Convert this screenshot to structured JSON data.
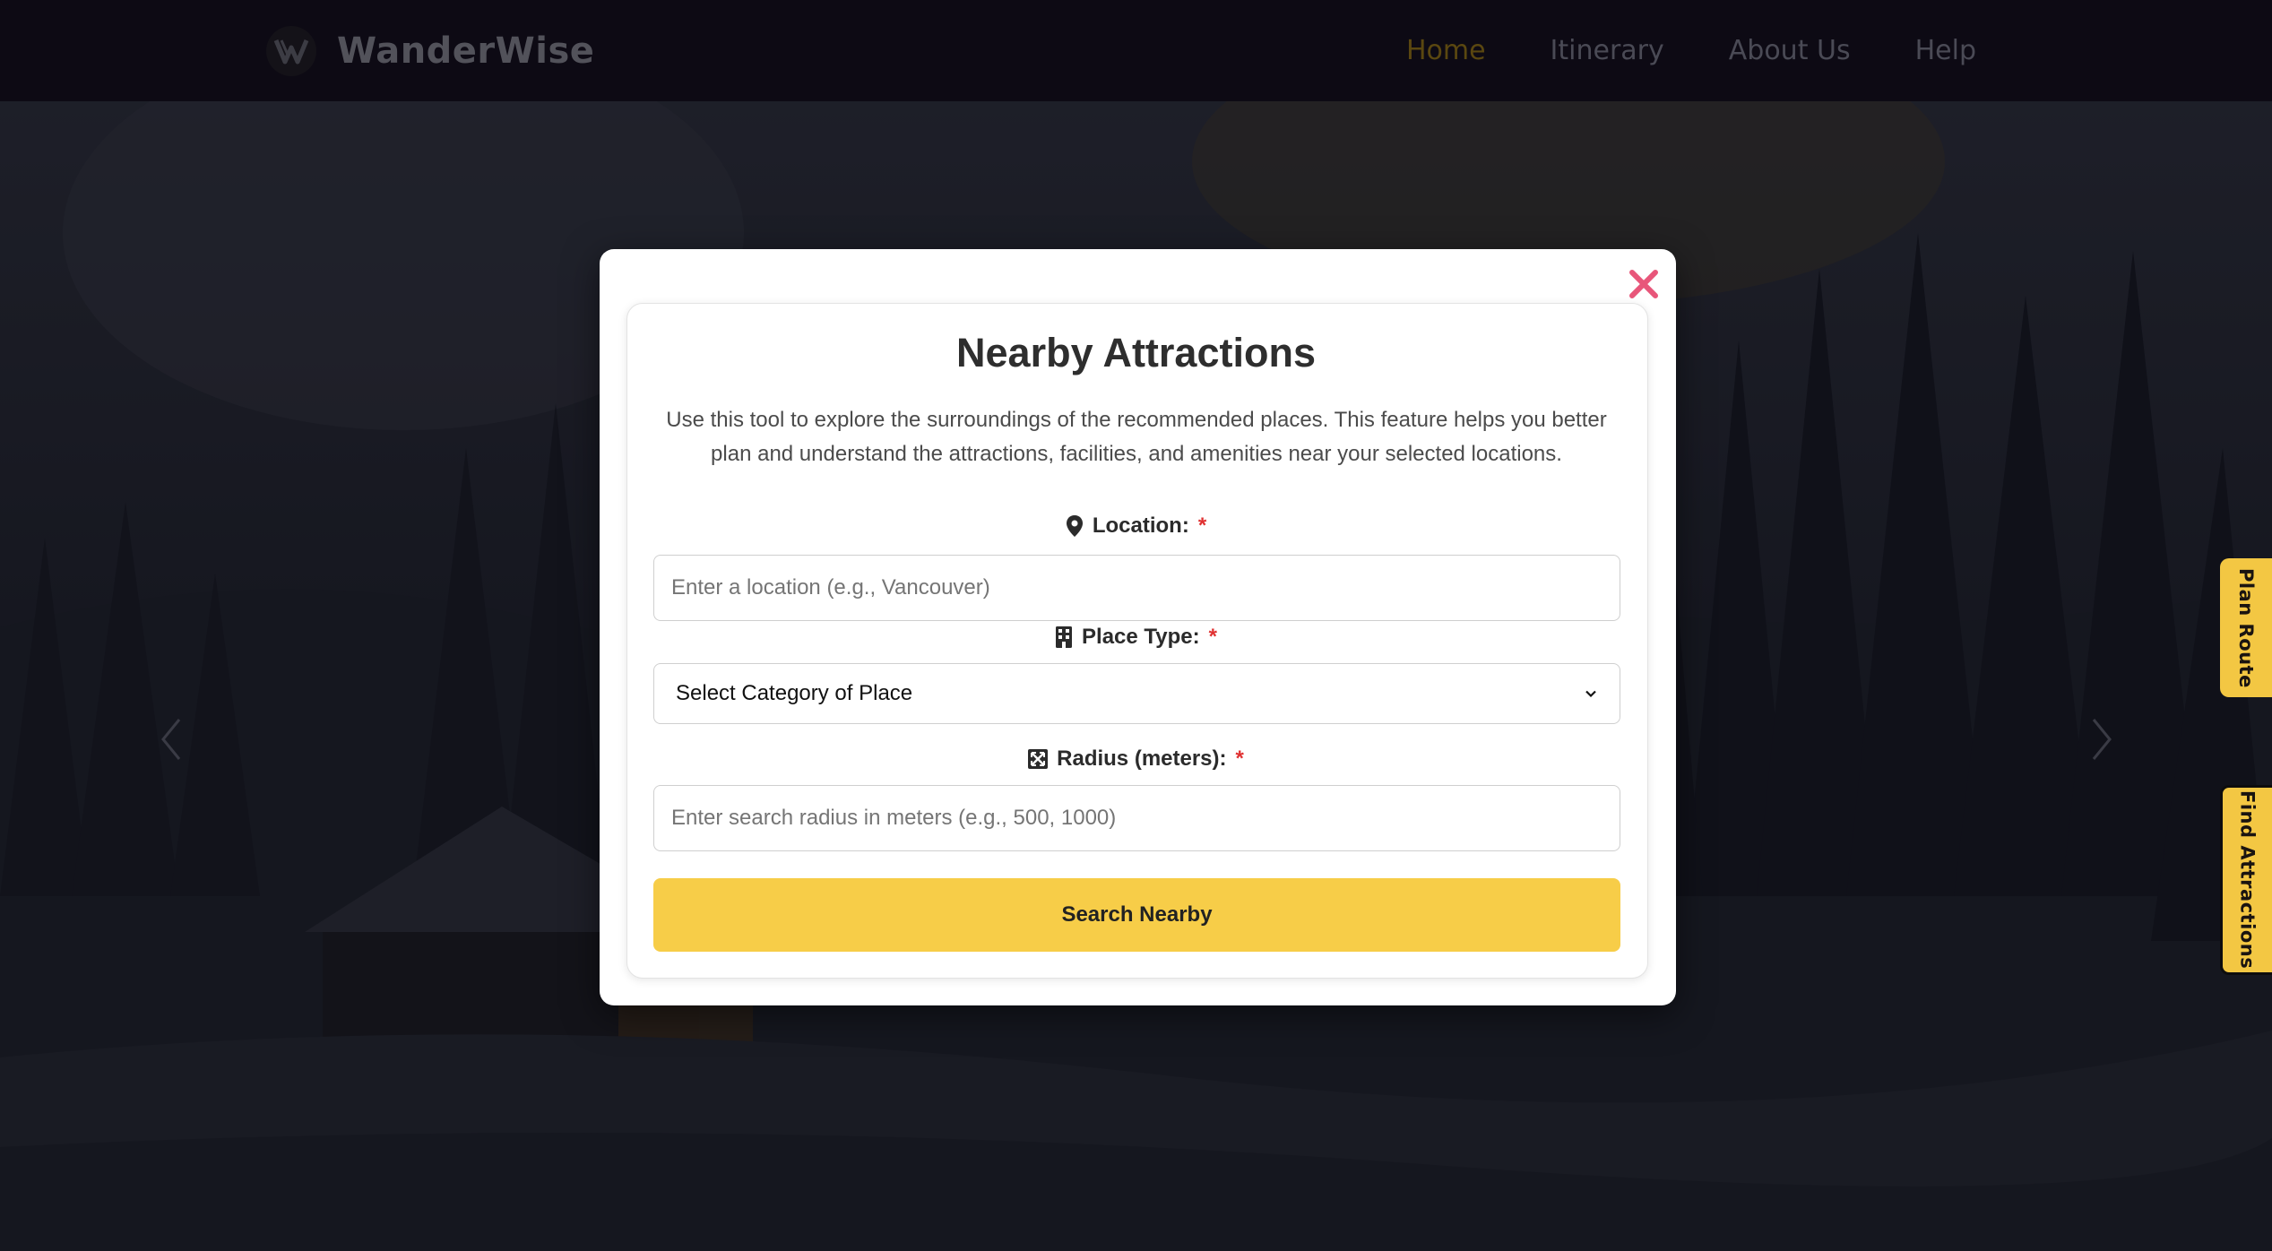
{
  "brand": {
    "name": "WanderWise",
    "logo_icon": "wanderwise-logo-icon"
  },
  "nav": {
    "items": [
      {
        "label": "Home",
        "active": true
      },
      {
        "label": "Itinerary",
        "active": false
      },
      {
        "label": "About Us",
        "active": false
      },
      {
        "label": "Help",
        "active": false
      }
    ]
  },
  "side_tabs": {
    "plan_route": "Plan Route",
    "find_attractions": "Find Attractions"
  },
  "modal": {
    "title": "Nearby Attractions",
    "description": "Use this tool to explore the surroundings of the recommended places. This feature helps you better plan and understand the attractions, facilities, and amenities near your selected locations.",
    "required_marker": "*",
    "location": {
      "label": "Location:",
      "icon": "map-pin-icon",
      "value": "",
      "placeholder": "Enter a location (e.g., Vancouver)"
    },
    "place_type": {
      "label": "Place Type:",
      "icon": "building-icon",
      "selected": "Select Category of Place"
    },
    "radius": {
      "label": "Radius (meters):",
      "icon": "expand-icon",
      "value": "",
      "placeholder": "Enter search radius in meters (e.g., 500, 1000)"
    },
    "submit_label": "Search Nearby"
  },
  "colors": {
    "accent_yellow": "#f7cd48",
    "close_red": "#e8567a",
    "required_red": "#e03131",
    "navbar_bg": "#0d0a14"
  }
}
